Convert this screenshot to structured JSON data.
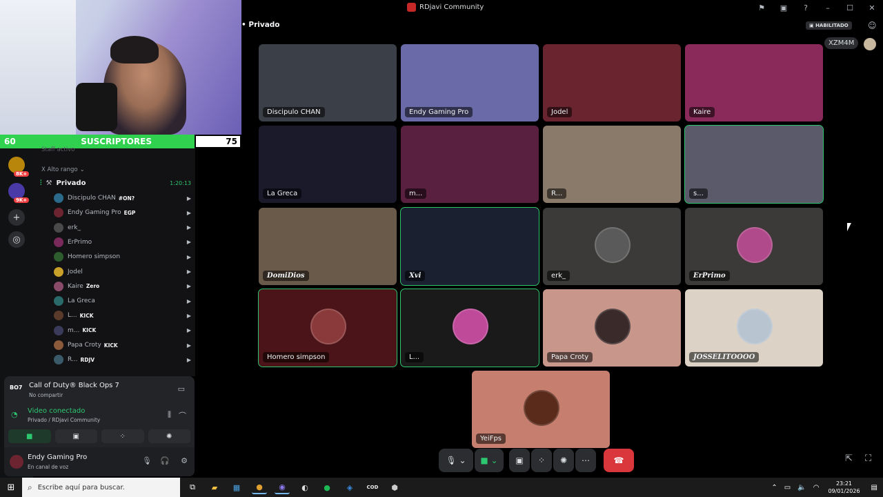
{
  "window": {
    "title": "RDjavi Community"
  },
  "overlay": {
    "left_count": "60",
    "label": "SUSCRIPTORES",
    "right_count": "75"
  },
  "rail": {
    "badges": [
      "8K+",
      "9K+"
    ]
  },
  "channels": {
    "hidden_category": "Staff activo",
    "category": "X Alto rango",
    "voice_channel": {
      "name": "Privado",
      "duration": "1:20:13"
    },
    "members": [
      {
        "name": "Discipulo CHAN",
        "tag": "#ON?",
        "color": "#2b6a8a"
      },
      {
        "name": "Endy Gaming Pro",
        "tag": "EGP",
        "color": "#6b2430"
      },
      {
        "name": "erk_",
        "tag": "",
        "color": "#4a4a4a"
      },
      {
        "name": "ErPrimo",
        "tag": "",
        "color": "#7a2a5a"
      },
      {
        "name": "Homero simpson",
        "tag": "",
        "color": "#2e5c2e"
      },
      {
        "name": "Jodel",
        "tag": "",
        "color": "#c8a02a"
      },
      {
        "name": "Kaire",
        "tag": "Zero",
        "color": "#8a4a6a"
      },
      {
        "name": "La Greca",
        "tag": "",
        "color": "#2a6a6a"
      },
      {
        "name": "L...",
        "tag": "KICK",
        "color": "#5a3a2a"
      },
      {
        "name": "m...",
        "tag": "KICK",
        "color": "#3a3a5a"
      },
      {
        "name": "Papa Croty",
        "tag": "KICK",
        "color": "#8a5a3a"
      },
      {
        "name": "R...",
        "tag": "RDJV",
        "color": "#3a5a6a"
      }
    ]
  },
  "voice_panel": {
    "game_logo": "BO7",
    "game_title": "Call of Duty® Black Ops 7",
    "game_status": "No compartir",
    "connection": "Video conectado",
    "connection_sub": "Privado / RDjavi Community"
  },
  "user": {
    "name": "Endy Gaming Pro",
    "status": "En canal de voz"
  },
  "stage": {
    "channel": "Privado",
    "badge": "HABILITADO",
    "viewer": "XZM4M",
    "tiles": [
      {
        "name": "Discipulo CHAN",
        "bg": "#3a3f48",
        "avatar": "",
        "speaking": false,
        "bold": false
      },
      {
        "name": "Endy Gaming Pro",
        "bg": "#6a6aa8",
        "avatar": "",
        "speaking": false,
        "bold": false
      },
      {
        "name": "Jodel",
        "bg": "#6a2430",
        "avatar": "",
        "speaking": false,
        "bold": false
      },
      {
        "name": "Kaire",
        "bg": "#8a2a5a",
        "avatar": "",
        "speaking": false,
        "bold": false
      },
      {
        "name": "La Greca",
        "bg": "#1a1a2a",
        "avatar": "",
        "speaking": false,
        "bold": false
      },
      {
        "name": "m...",
        "bg": "#5a2040",
        "avatar": "",
        "speaking": false,
        "bold": false
      },
      {
        "name": "R...",
        "bg": "#8a7a6a",
        "avatar": "",
        "speaking": false,
        "bold": false
      },
      {
        "name": "s...",
        "bg": "#5a5a6a",
        "avatar": "",
        "speaking": true,
        "bold": false
      },
      {
        "name": "DomiDios",
        "bg": "#6a5a4a",
        "avatar": "",
        "speaking": false,
        "bold": true
      },
      {
        "name": "Xvi",
        "bg": "#1a2030",
        "avatar": "",
        "speaking": true,
        "bold": true
      },
      {
        "name": "erk_",
        "bg": "#3b3a38",
        "avatar": "#5a5a5a",
        "speaking": false,
        "bold": false
      },
      {
        "name": "ErPrimo",
        "bg": "#3b3a38",
        "avatar": "#b04a8a",
        "speaking": false,
        "bold": true
      },
      {
        "name": "Homero simpson",
        "bg": "#4a1418",
        "avatar": "#8a3a3a",
        "speaking": true,
        "bold": false
      },
      {
        "name": "L...",
        "bg": "#1a1a1a",
        "avatar": "#c04a9a",
        "speaking": true,
        "bold": false
      },
      {
        "name": "Papa Croty",
        "bg": "#c8968a",
        "avatar": "#3a2a2a",
        "speaking": false,
        "bold": false
      },
      {
        "name": "JOSSELITOOOO",
        "bg": "#dcd2c6",
        "avatar": "#b8c4d0",
        "speaking": false,
        "bold": true
      },
      {
        "name": "YeiFps",
        "bg": "#c67f6e",
        "avatar": "#5a2a1a",
        "speaking": false,
        "bold": false
      }
    ]
  },
  "taskbar": {
    "search_placeholder": "Escribe aquí para buscar.",
    "time": "23:21",
    "date": "09/01/2026"
  }
}
